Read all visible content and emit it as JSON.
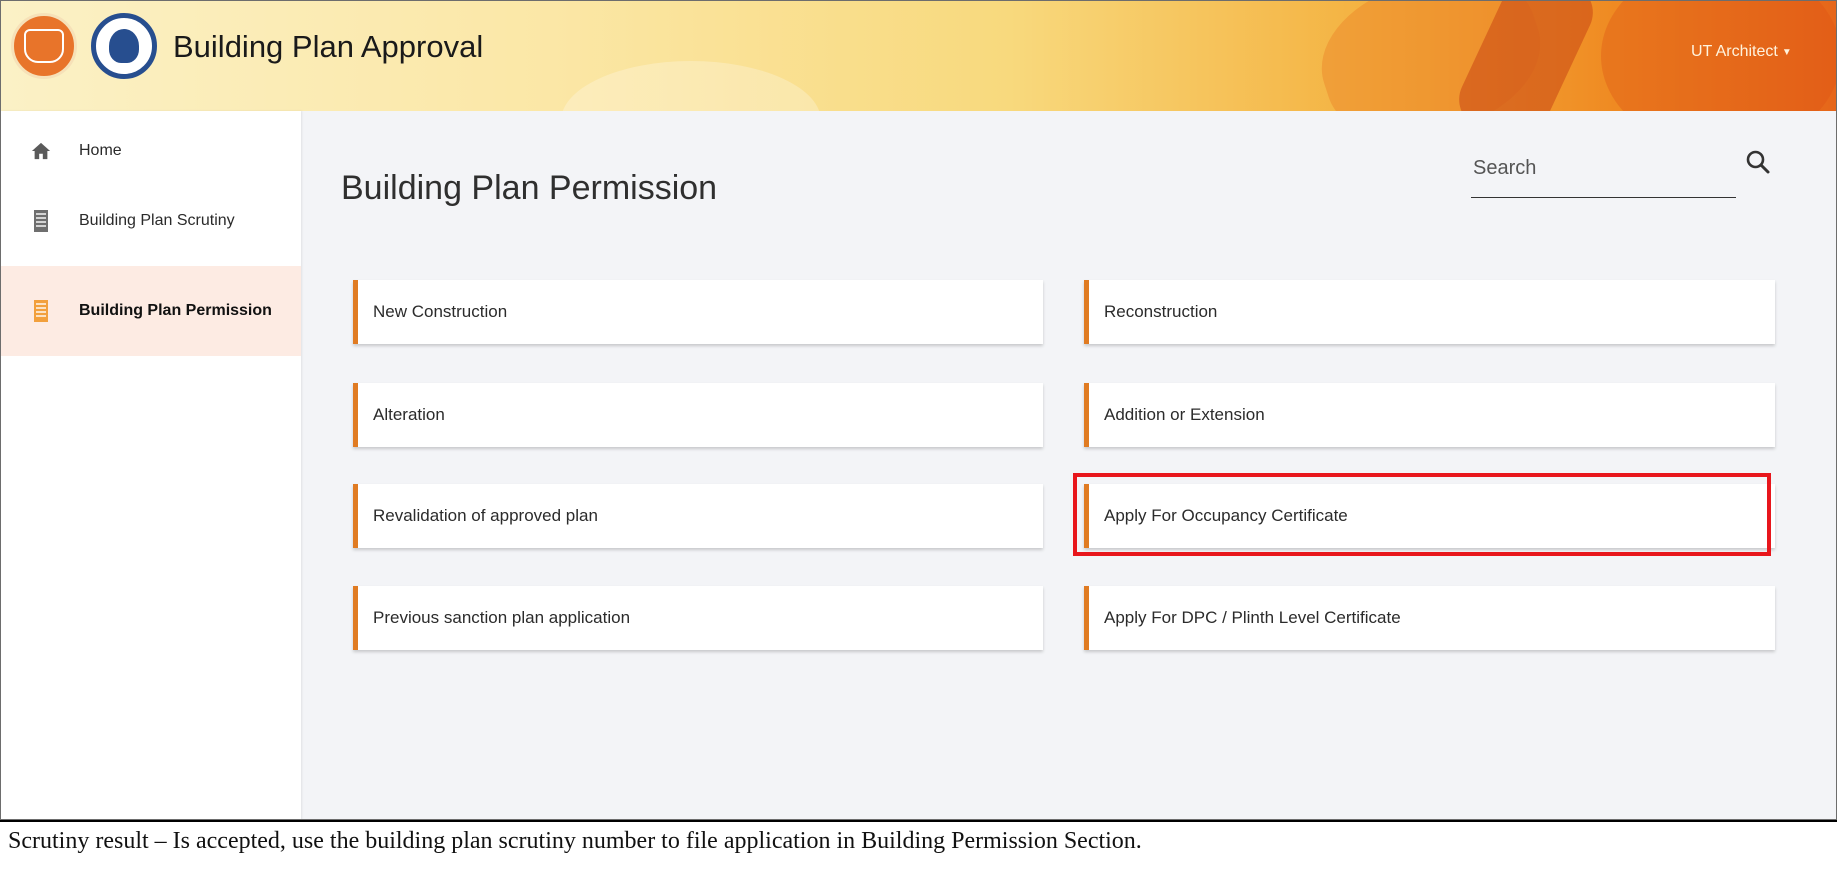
{
  "header": {
    "app_title": "Building Plan Approval",
    "user_label": "UT Architect",
    "logos": [
      "ut-administration-logo",
      "municipal-corporation-chandigarh-logo"
    ]
  },
  "sidebar": {
    "items": [
      {
        "label": "Home",
        "icon": "home-icon",
        "active": false
      },
      {
        "label": "Building Plan Scrutiny",
        "icon": "building-icon",
        "active": false
      },
      {
        "label": "Building Plan Permission",
        "icon": "building-icon",
        "active": true
      }
    ]
  },
  "main": {
    "title": "Building Plan Permission",
    "search": {
      "placeholder": "Search",
      "value": ""
    },
    "cards": [
      {
        "label": "New Construction"
      },
      {
        "label": "Reconstruction"
      },
      {
        "label": "Alteration"
      },
      {
        "label": "Addition or Extension"
      },
      {
        "label": "Revalidation of approved plan"
      },
      {
        "label": "Apply For Occupancy Certificate",
        "highlighted": true
      },
      {
        "label": "Previous sanction plan application"
      },
      {
        "label": "Apply For DPC / Plinth Level Certificate"
      }
    ]
  },
  "caption": {
    "text": "Scrutiny result – Is accepted, use the building plan scrutiny number to file application in Building Permission Section."
  },
  "colors": {
    "accent": "#e07b22",
    "highlight_box": "#e8161c",
    "active_sidebar_bg": "#fdebe3"
  }
}
